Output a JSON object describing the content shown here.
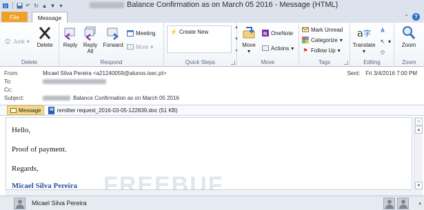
{
  "window": {
    "title_suffix": "Balance Confirmation as on March 05 2016  -  Message (HTML)"
  },
  "tabs": {
    "file": "File",
    "message": "Message"
  },
  "ribbon": {
    "groups": {
      "delete": "Delete",
      "respond": "Respond",
      "quick_steps": "Quick Steps",
      "move": "Move",
      "tags": "Tags",
      "editing": "Editing",
      "zoom": "Zoom"
    },
    "buttons": {
      "junk": "Junk",
      "delete": "Delete",
      "reply": "Reply",
      "reply_all_1": "Reply",
      "reply_all_2": "All",
      "forward": "Forward",
      "meeting": "Meeting",
      "more": "More",
      "create_new": "Create New",
      "move": "Move",
      "onenote": "OneNote",
      "actions": "Actions",
      "mark_unread": "Mark Unread",
      "categorize": "Categorize",
      "follow_up": "Follow Up",
      "translate": "Translate",
      "zoom": "Zoom"
    }
  },
  "header": {
    "from_label": "From:",
    "from_value": "Micael Silva Pereira <a21240059@alunos.isec.pt>",
    "to_label": "To:",
    "cc_label": "Cc:",
    "subject_label": "Subject:",
    "subject_value": "Balance Confirmation as on March 05 2016",
    "sent_label": "Sent:",
    "sent_value": "Fri 3/4/2016 7:00 PM"
  },
  "attachments": {
    "message_tab": "Message",
    "file": "remitter request_2016-03-05-122839.doc (51 KB)"
  },
  "body": {
    "greeting": "Hello,",
    "line1": "Proof of payment.",
    "closing": "Regards,",
    "signature": "Micael Silva Pereira"
  },
  "watermark": "FREEBUF",
  "people_pane": {
    "name": "Micael Silva Pereira"
  },
  "colors": {
    "file_tab": "#f0a02a",
    "signature": "#2a4f9a",
    "accent": "#2a6dc8"
  }
}
